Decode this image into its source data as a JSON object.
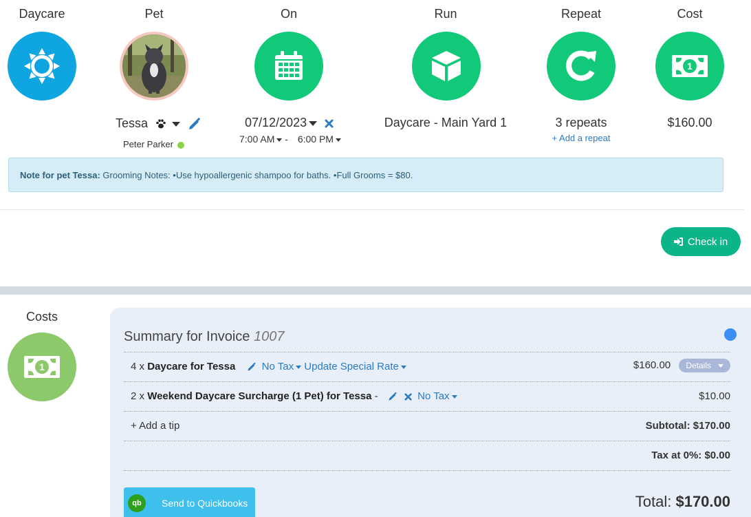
{
  "columns": {
    "daycare": {
      "title": "Daycare"
    },
    "pet": {
      "title": "Pet",
      "name": "Tessa",
      "owner": "Peter Parker"
    },
    "on": {
      "title": "On",
      "date": "07/12/2023",
      "start_time": "7:00 AM",
      "separator": "-",
      "end_time": "6:00 PM"
    },
    "run": {
      "title": "Run",
      "value": "Daycare - Main Yard 1"
    },
    "repeat": {
      "title": "Repeat",
      "value": "3 repeats",
      "add_link": "+ Add a repeat"
    },
    "cost": {
      "title": "Cost",
      "value": "$160.00"
    }
  },
  "note": {
    "label": "Note for pet Tessa:",
    "text": "Grooming Notes: •Use hypoallergenic shampoo for baths. •Full Grooms = $80."
  },
  "checkin_label": "Check in",
  "costs": {
    "title": "Costs",
    "invoice_title": "Summary for Invoice",
    "invoice_number": "1007",
    "lines": [
      {
        "qty": "4 x",
        "name": "Daycare for Tessa",
        "tax": "No Tax",
        "special": "Update Special Rate",
        "amount": "$160.00",
        "details": "Details"
      },
      {
        "qty": "2 x",
        "name": "Weekend Daycare Surcharge (1 Pet) for Tessa",
        "dash": "-",
        "tax": "No Tax",
        "amount": "$10.00"
      }
    ],
    "add_tip": "+ Add a tip",
    "subtotal": "Subtotal: $170.00",
    "tax": "Tax at 0%: $0.00",
    "total_label": "Total:",
    "total_value": "$170.00",
    "quickbooks_label": "Send to Quickbooks",
    "quickbooks_logo": "qb"
  },
  "colors": {
    "blue": "#0ea5e0",
    "green": "#12c97a",
    "costs_green": "#8cc96a",
    "checkin": "#0bb589",
    "link": "#2a7ac4"
  },
  "icons": [
    "sun-icon",
    "calendar-icon",
    "cube-icon",
    "refresh-icon",
    "money-icon",
    "paw-icon",
    "pencil-icon",
    "close-icon",
    "sign-in-icon",
    "quickbooks-icon"
  ]
}
